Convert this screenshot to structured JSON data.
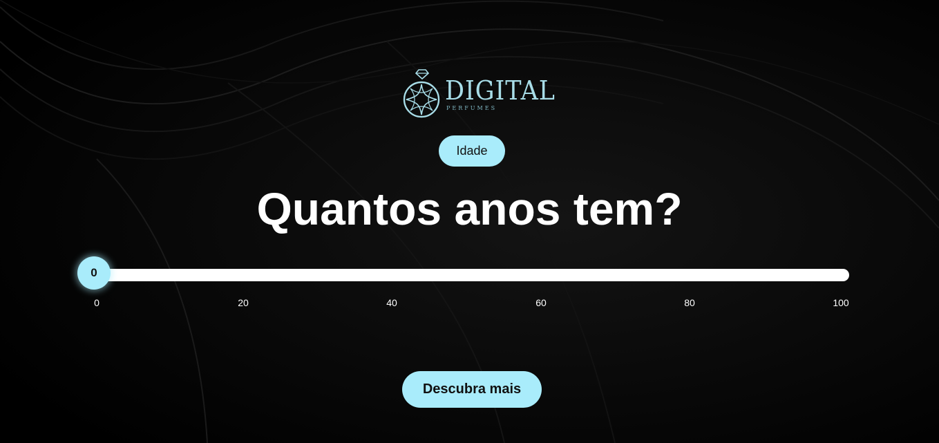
{
  "brand": {
    "name": "DIGITAL",
    "subtitle": "PERFUMES",
    "accent_color": "#a9ecfb"
  },
  "badge": {
    "label": "Idade"
  },
  "question": {
    "title": "Quantos anos tem?"
  },
  "age_slider": {
    "value": "0",
    "min": 0,
    "max": 100,
    "ticks": [
      "0",
      "20",
      "40",
      "60",
      "80",
      "100"
    ]
  },
  "cta": {
    "label": "Descubra mais"
  },
  "icons": {
    "logo": "diamond-ring-logo-icon"
  }
}
